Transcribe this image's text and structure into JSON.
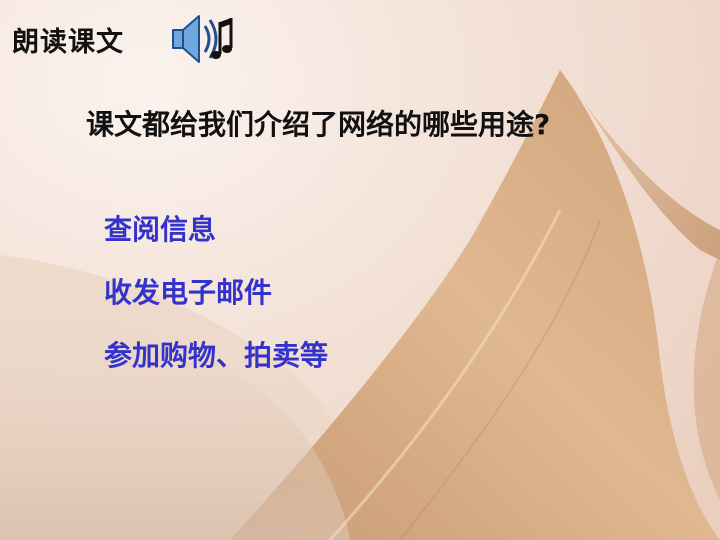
{
  "slide": {
    "title": "朗读课文",
    "audio_icon": "speaker-icon",
    "question": "课文都给我们介绍了网络的哪些用途?",
    "answers": [
      "查阅信息",
      "收发电子邮件",
      "参加购物、拍卖等"
    ],
    "colors": {
      "background": "#f3e1d6",
      "paper": "#d9ae86",
      "title_text": "#111111",
      "answer_text": "#3333cc"
    }
  }
}
